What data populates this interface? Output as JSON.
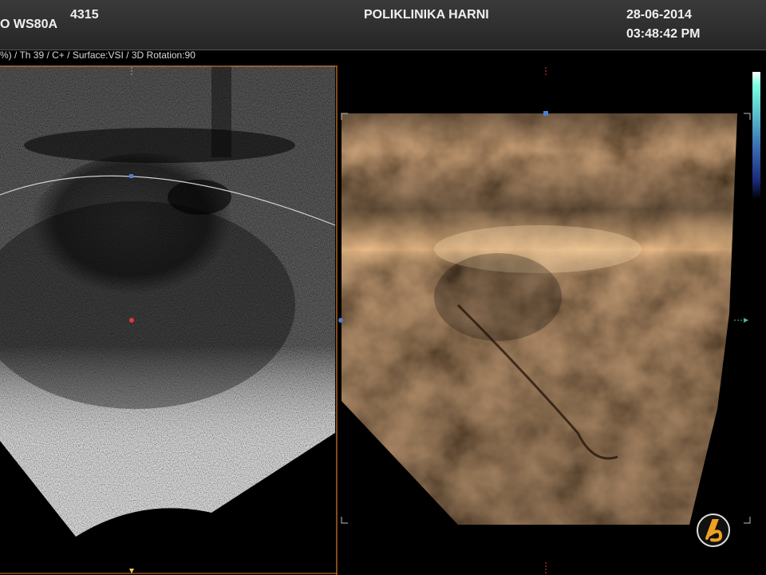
{
  "header": {
    "model": "O WS80A",
    "patient_id": "4315",
    "institution": "POLIKLINIKA HARNI",
    "date": "28-06-2014",
    "time": "03:48:42 PM"
  },
  "params_line": "%) / Th 39 / C+ / Surface:VSI / 3D Rotation:90",
  "colors": {
    "header_bg": "#2e2e2e",
    "accent_frame": "#d47a2a",
    "cursor_blue": "#4a7fd0",
    "cursor_red": "#e03a3a",
    "marker_yellow": "#e8d44a",
    "grayscale_bar_top": "#7fffe0",
    "grayscale_bar_bottom": "#1a2a7a"
  },
  "icons": {
    "logo": "samsung-medison-logo-icon"
  }
}
